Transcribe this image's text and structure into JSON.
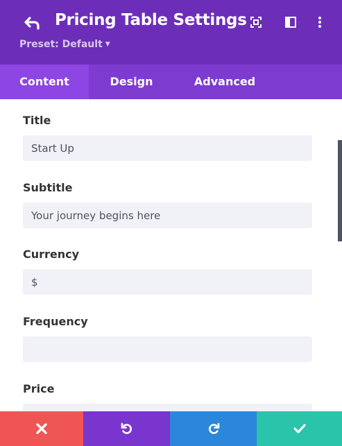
{
  "header": {
    "title": "Pricing Table Settings",
    "preset_label": "Preset: Default",
    "icons": [
      "back-arrow-icon",
      "expand-icon",
      "split-view-icon",
      "more-vertical-icon"
    ]
  },
  "tabs": [
    {
      "label": "Content",
      "active": true
    },
    {
      "label": "Design",
      "active": false
    },
    {
      "label": "Advanced",
      "active": false
    }
  ],
  "fields": {
    "title": {
      "label": "Title",
      "value": "Start Up"
    },
    "subtitle": {
      "label": "Subtitle",
      "value": "Your journey begins here"
    },
    "currency": {
      "label": "Currency",
      "value": "$"
    },
    "frequency": {
      "label": "Frequency",
      "value": ""
    },
    "price": {
      "label": "Price",
      "value": ""
    }
  },
  "footer": {
    "buttons": [
      {
        "name": "cancel",
        "icon": "close-icon",
        "color": "#ef5555"
      },
      {
        "name": "undo",
        "icon": "undo-icon",
        "color": "#7b35cf"
      },
      {
        "name": "redo",
        "icon": "redo-icon",
        "color": "#2b87da"
      },
      {
        "name": "save",
        "icon": "check-icon",
        "color": "#29c4a9"
      }
    ]
  },
  "colors": {
    "header_bg": "#6c2eb9",
    "tabs_bg": "#7e3bd0",
    "active_tab_bg": "#8d45e3",
    "input_bg": "#f0f2f7"
  }
}
